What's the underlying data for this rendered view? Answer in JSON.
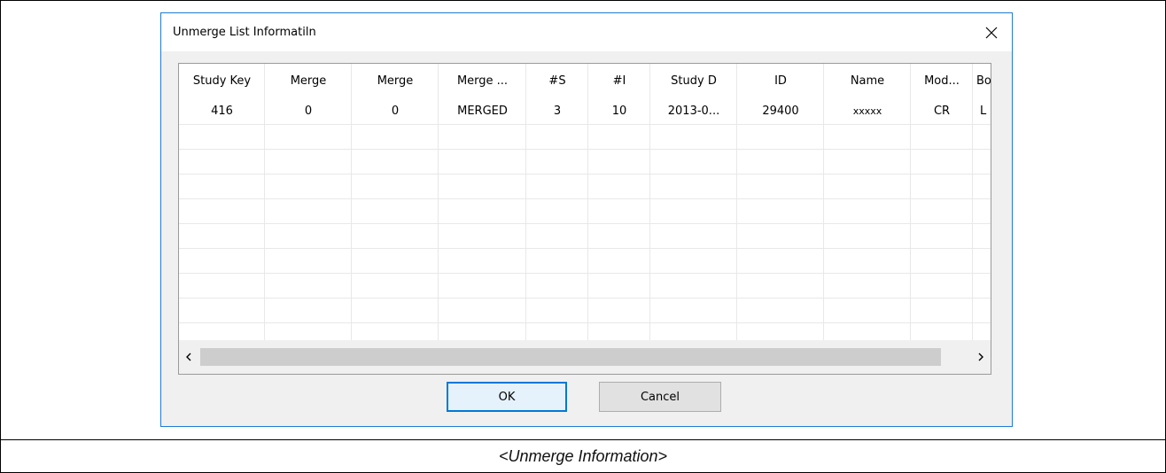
{
  "dialog": {
    "title": "Unmerge List Informatiln",
    "close_glyph": "✕",
    "ok_label": "OK",
    "cancel_label": "Cancel"
  },
  "table": {
    "columns": [
      "Study Key",
      "Merge",
      "Merge",
      "Merge ...",
      "#S",
      "#I",
      "Study D",
      "ID",
      "Name",
      "Mod...",
      "Bo"
    ],
    "rows": [
      [
        "416",
        "0",
        "0",
        "MERGED",
        "3",
        "10",
        "2013-0...",
        "29400",
        "xxxxx",
        "CR",
        "L"
      ]
    ]
  },
  "scrollbar": {
    "left_arrow": "<",
    "right_arrow": ">"
  },
  "caption": "<Unmerge Information>"
}
